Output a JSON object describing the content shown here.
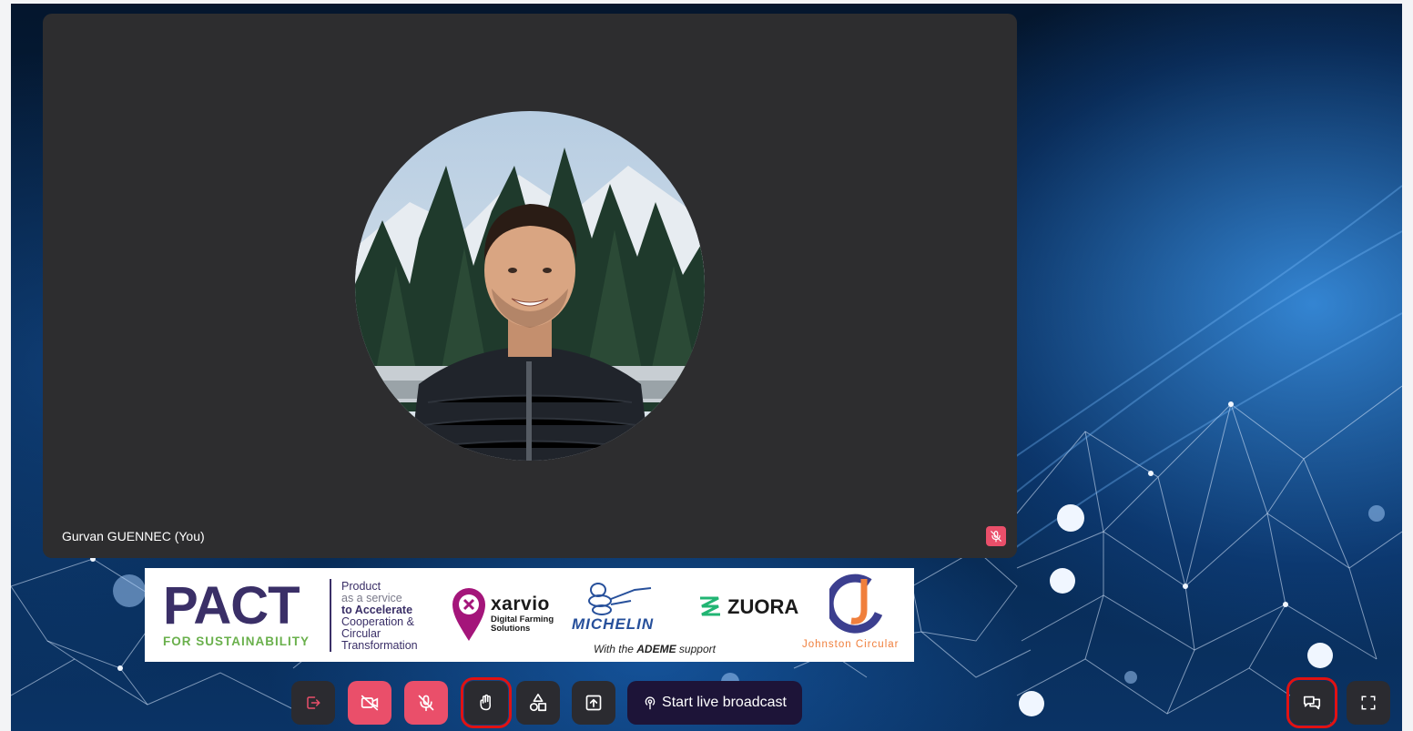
{
  "meeting": {
    "participant_name": "Gurvan GUENNEC (You)",
    "avatar_icon": "participant-photo"
  },
  "sponsor_banner": {
    "pact_logo": "PACT",
    "pact_subtitle": "FOR SUSTAINABILITY",
    "pact_tagline": [
      "Product",
      "as a service",
      "to Accelerate",
      "Cooperation &",
      "Circular",
      "Transformation"
    ],
    "xarvio_name": "xarvio",
    "xarvio_subtitle": [
      "Digital Farming",
      "Solutions"
    ],
    "michelin_name": "MICHELIN",
    "zuora_name": "ZUORA",
    "ademe_prefix": "With the ",
    "ademe_bold": "ADEME",
    "ademe_suffix": " support",
    "johnston_name": "Johnston Circular"
  },
  "controls": {
    "leave_icon": "leave-icon",
    "camera_icon": "camera-off-icon",
    "mic_icon": "mic-off-icon",
    "hand_icon": "raise-hand-icon",
    "shapes_icon": "shapes-icon",
    "share_icon": "share-screen-icon",
    "broadcast_label": "Start live broadcast",
    "chat_icon": "chat-icon",
    "fullscreen_icon": "fullscreen-icon"
  },
  "colors": {
    "tile_bg": "#2d2d2f",
    "danger": "#ea4f6a",
    "control_dark": "#2b2b30",
    "broadcast_bg": "#1d1438",
    "highlight": "#e11212",
    "pact_purple": "#3a2f67",
    "pact_green": "#6ab04c"
  }
}
